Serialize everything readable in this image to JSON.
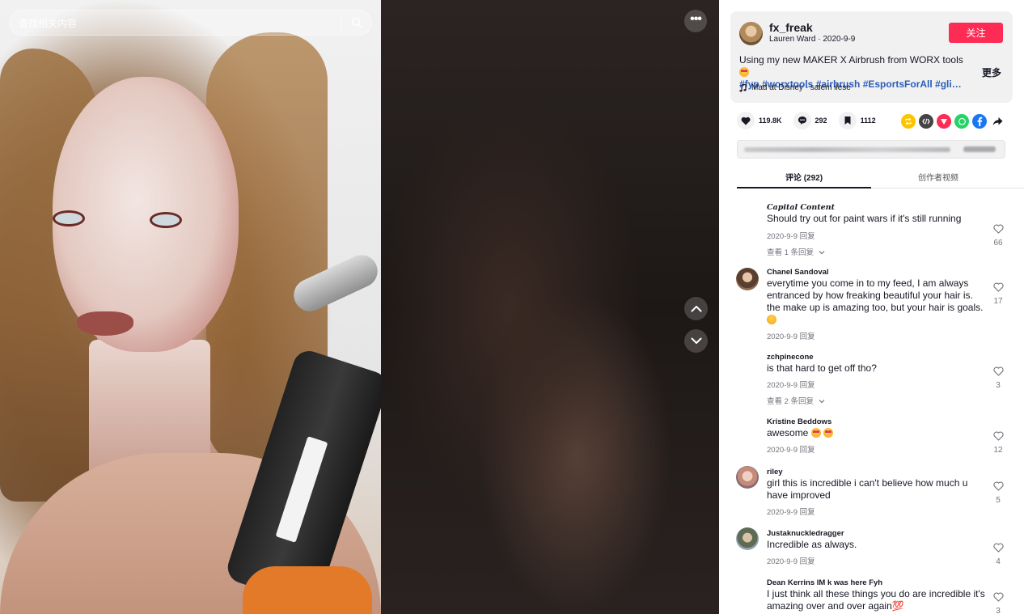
{
  "search": {
    "placeholder": "查找相关内容"
  },
  "author": {
    "username": "fx_freak",
    "display_name": "Lauren Ward",
    "date": "2020-9-9",
    "follow_label": "关注"
  },
  "caption": {
    "text": "Using my new MAKER X Airbrush from WORX tools",
    "emoji": "heart-eyes-emoji",
    "hashtags": "#fyp #worxtools #airbrush #EsportsForAll #glitter...",
    "more_label": "更多"
  },
  "music": {
    "title": "Mad at Disney - salem ilese"
  },
  "stats": {
    "likes": "119.8K",
    "comments": "292",
    "saves": "1112"
  },
  "share_icons": [
    "repost-icon",
    "embed-icon",
    "friends-icon",
    "whatsapp-icon",
    "facebook-icon",
    "share-arrow-icon"
  ],
  "colors": {
    "follow": "#fe2c55",
    "hashtag": "#2b5db9",
    "repost": "#ffc400",
    "embed": "#444444",
    "friends": "#fe2c55",
    "whatsapp": "#25d366",
    "facebook": "#1877f2"
  },
  "tabs": {
    "comments": "评论 (292)",
    "creator_videos": "创作者视频"
  },
  "comments": [
    {
      "name": "Capital Content",
      "text": "Should try out for paint wars if it's still running",
      "date": "2020-9-9",
      "reply_label": "回复",
      "likes": "66",
      "replies": "查看 1 条回复"
    },
    {
      "name": "Chanel Sandoval",
      "text": "everytime you come in to my feed, I am always entranced by how freaking beautiful your hair is. the make up is amazing too, but your hair is goals.",
      "date": "2020-9-9",
      "reply_label": "回复",
      "likes": "17"
    },
    {
      "name": "zchpinecone",
      "text": "is that hard to get off tho?",
      "date": "2020-9-9",
      "reply_label": "回复",
      "likes": "3",
      "replies": "查看 2 条回复"
    },
    {
      "name": "Kristine Beddows",
      "text": "awesome",
      "date": "2020-9-9",
      "reply_label": "回复",
      "likes": "12"
    },
    {
      "name": "riley",
      "text": "girl this is incredible i can't believe how much u have improved",
      "date": "2020-9-9",
      "reply_label": "回复",
      "likes": "5"
    },
    {
      "name": "Justaknuckledragger",
      "text": "Incredible as always.",
      "date": "2020-9-9",
      "reply_label": "回复",
      "likes": "4"
    },
    {
      "name": "Dean Kerrins IM k was here Fyh",
      "text": "I just think all these things you do are incredible it's amazing over and over again💯",
      "likes": "3"
    }
  ]
}
